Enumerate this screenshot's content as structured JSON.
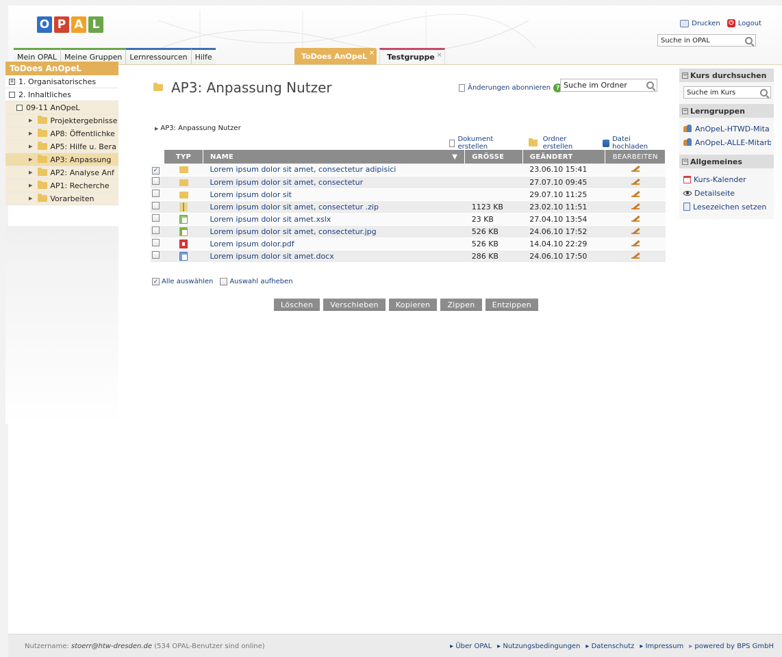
{
  "header": {
    "logo_letters": [
      "O",
      "P",
      "A",
      "L"
    ],
    "logo_colors": [
      "#2f6ec4",
      "#d1432f",
      "#f1a22a",
      "#6da54b"
    ],
    "print_label": "Drucken",
    "logout_label": "Logout",
    "search_value": "Suche in OPAL"
  },
  "mainnav": [
    "Mein OPAL",
    "Meine Gruppen",
    "Lernressourcen",
    "Hilfe"
  ],
  "tabs": [
    {
      "label": "ToDoes AnOpeL",
      "close": "×"
    },
    {
      "label": "Testgruppe",
      "close": "×"
    }
  ],
  "leftnav": {
    "title": "ToDoes AnOpeL",
    "items": [
      {
        "label": "1. Organisatorisches",
        "marker": "+"
      },
      {
        "label": "2. Inhaltliches",
        "marker": ""
      },
      {
        "label": "09-11 AnOpeL",
        "marker": ""
      },
      {
        "label": "Projektergebnisse"
      },
      {
        "label": "AP8: Öffentlichke"
      },
      {
        "label": "AP5: Hilfe u. Bera"
      },
      {
        "label": "AP3: Anpassung"
      },
      {
        "label": "AP2: Analyse Anf"
      },
      {
        "label": "AP1: Recherche"
      },
      {
        "label": "Vorarbeiten"
      }
    ]
  },
  "main": {
    "title": "AP3: Anpassung Nutzer",
    "subscribe_label": "Änderungen abonnieren",
    "folder_search_value": "Suche im Ordner",
    "breadcrumb": "AP3: Anpassung Nutzer",
    "actions": {
      "create_doc": "Dokument erstellen",
      "create_folder": "Ordner erstellen",
      "upload": "Datei hochladen"
    },
    "columns": {
      "type": "TYP",
      "name": "NAME",
      "size": "GRÖSSE",
      "changed": "GEÄNDERT",
      "edit": "BEARBEITEN"
    },
    "rows": [
      {
        "checked": "✓",
        "type": "folder",
        "name": "Lorem ipsum dolor sit amet, consectetur adipisici",
        "size": "",
        "changed": "23.06.10 15:41"
      },
      {
        "checked": "",
        "type": "folder",
        "name": "Lorem ipsum dolor sit amet, consectetur",
        "size": "",
        "changed": "27.07.10 09:45"
      },
      {
        "checked": "",
        "type": "folder",
        "name": "Lorem ipsum dolor sit",
        "size": "",
        "changed": "29.07.10 11:25"
      },
      {
        "checked": "",
        "type": "zip",
        "name": "Lorem ipsum dolor sit amet, consectetur .zip",
        "size": "1123 KB",
        "changed": "23.02.10 11:51"
      },
      {
        "checked": "",
        "type": "xls",
        "name": "Lorem ipsum dolor sit amet.xslx",
        "size": "23 KB",
        "changed": "27.04.10 13:54"
      },
      {
        "checked": "",
        "type": "jpg",
        "name": "Lorem ipsum dolor sit amet, consectetur.jpg",
        "size": "526 KB",
        "changed": "24.06.10 17:52"
      },
      {
        "checked": "",
        "type": "pdf",
        "name": "Lorem ipsum dolor.pdf",
        "size": "526 KB",
        "changed": "14.04.10 22:29"
      },
      {
        "checked": "",
        "type": "doc",
        "name": "Lorem ipsum dolor sit amet.docx",
        "size": "286 KB",
        "changed": "24.06.10 17:50"
      }
    ],
    "select_all_label": "Alle auswählen",
    "deselect_label": "Auswahl aufheben",
    "buttons": [
      "Löschen",
      "Verschieben",
      "Kopieren",
      "Zippen",
      "Entzippen"
    ]
  },
  "rightbar": {
    "search_section": "Kurs durchsuchen",
    "search_value": "Suche im Kurs",
    "groups_section": "Lerngruppen",
    "groups": [
      "AnOpeL-HTWD-Mita",
      "AnOpeL-ALLE-Mitarb"
    ],
    "general_section": "Allgemeines",
    "general_links": [
      "Kurs-Kalender",
      "Detailseite",
      "Lesezeichen setzen"
    ]
  },
  "footer": {
    "user_label": "Nutzername:",
    "user": "stoerr@htw-dresden.de",
    "online": "(534 OPAL-Benutzer sind online)",
    "links": [
      "Über OPAL",
      "Nutzungsbedingungen",
      "Datenschutz",
      "Impressum",
      "powered by BPS GmbH"
    ]
  }
}
